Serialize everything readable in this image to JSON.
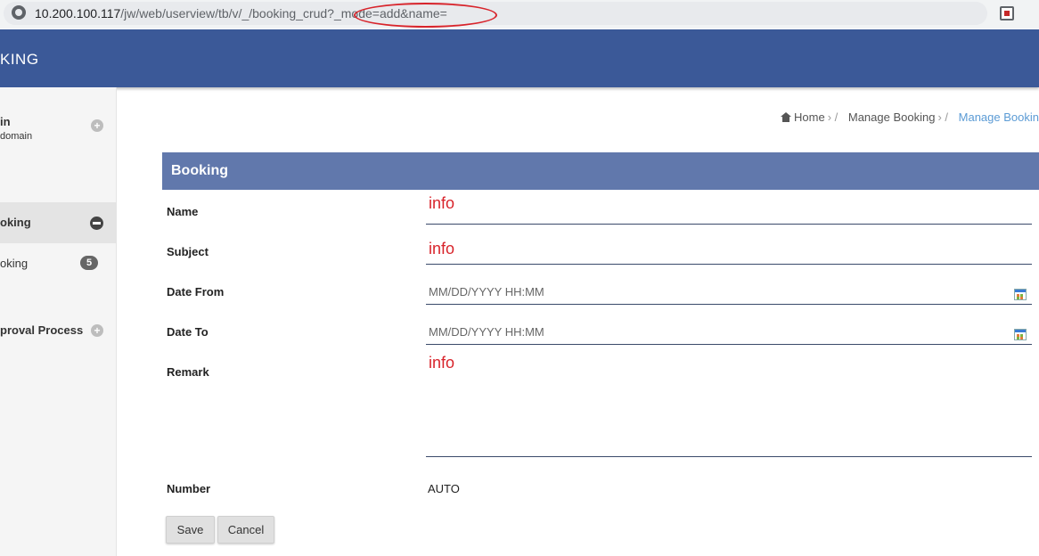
{
  "browser": {
    "url_host": "10.200.100.117",
    "url_path": "/jw/web/userview/tb/v/_/booking_crud?_mode=add&name="
  },
  "header": {
    "app_title": "KING"
  },
  "sidebar": {
    "user_name": "in",
    "user_domain": "domain",
    "items": [
      {
        "label": "oking",
        "active": true
      },
      {
        "label": "oking",
        "badge": "5"
      },
      {
        "label": "proval Process"
      }
    ]
  },
  "breadcrumb": {
    "items": [
      "Home",
      "Manage Booking",
      "Manage Bookin"
    ]
  },
  "form": {
    "title": "Booking",
    "fields": [
      {
        "label": "Name",
        "value": "info"
      },
      {
        "label": "Subject",
        "value": "info"
      },
      {
        "label": "Date From",
        "placeholder": "MM/DD/YYYY HH:MM"
      },
      {
        "label": "Date To",
        "placeholder": "MM/DD/YYYY HH:MM"
      },
      {
        "label": "Remark",
        "value": "info"
      },
      {
        "label": "Number",
        "value": "AUTO"
      }
    ],
    "buttons": {
      "save": "Save",
      "cancel": "Cancel"
    }
  },
  "colors": {
    "header_bg": "#3b5998",
    "panel_header_bg": "#6178ac",
    "annotation_red": "#d8242b",
    "breadcrumb_active": "#5b9bd5"
  },
  "icons": [
    "site-info-icon",
    "extension-icon",
    "home-icon",
    "plus-circle-icon",
    "minus-circle-icon",
    "calendar-icon"
  ]
}
